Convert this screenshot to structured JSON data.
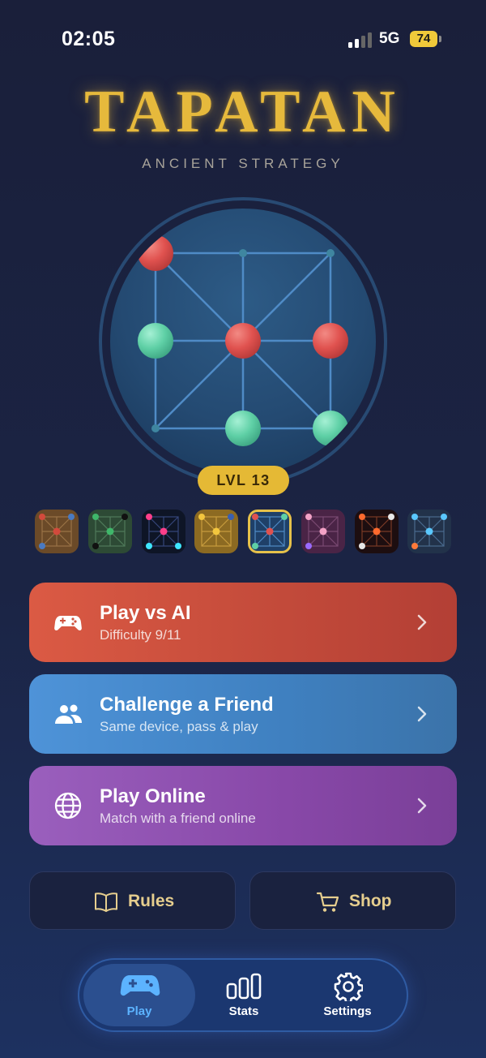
{
  "status": {
    "time": "02:05",
    "network": "5G",
    "battery": "74"
  },
  "title": "TAPATAN",
  "subtitle": "ANCIENT STRATEGY",
  "level_badge": "LVL 13",
  "board": {
    "red_pieces": [
      "top-left",
      "center",
      "middle-right"
    ],
    "teal_pieces": [
      "middle-left",
      "bottom-center",
      "bottom-right"
    ],
    "colors": {
      "red": "#e0524f",
      "teal": "#5fd0a6",
      "lines": "#4f8bc6"
    }
  },
  "themes": [
    {
      "name": "wood",
      "selected": false
    },
    {
      "name": "forest",
      "selected": false
    },
    {
      "name": "neon",
      "selected": false
    },
    {
      "name": "gold",
      "selected": false
    },
    {
      "name": "ocean",
      "selected": true
    },
    {
      "name": "purple",
      "selected": false
    },
    {
      "name": "ember",
      "selected": false
    },
    {
      "name": "slate",
      "selected": false
    }
  ],
  "modes": {
    "ai": {
      "title": "Play vs AI",
      "subtitle": "Difficulty 9/11",
      "icon": "gamepad-icon",
      "color": "#d2523f"
    },
    "friend": {
      "title": "Challenge a Friend",
      "subtitle": "Same device, pass & play",
      "icon": "users-icon",
      "color": "#4589cc"
    },
    "online": {
      "title": "Play Online",
      "subtitle": "Match with a friend online",
      "icon": "globe-icon",
      "color": "#8f52b0"
    }
  },
  "secondary": {
    "rules": "Rules",
    "shop": "Shop"
  },
  "nav": [
    {
      "label": "Play",
      "icon": "gamepad-icon",
      "active": true
    },
    {
      "label": "Stats",
      "icon": "bar-chart-icon",
      "active": false
    },
    {
      "label": "Settings",
      "icon": "gear-icon",
      "active": false
    }
  ]
}
